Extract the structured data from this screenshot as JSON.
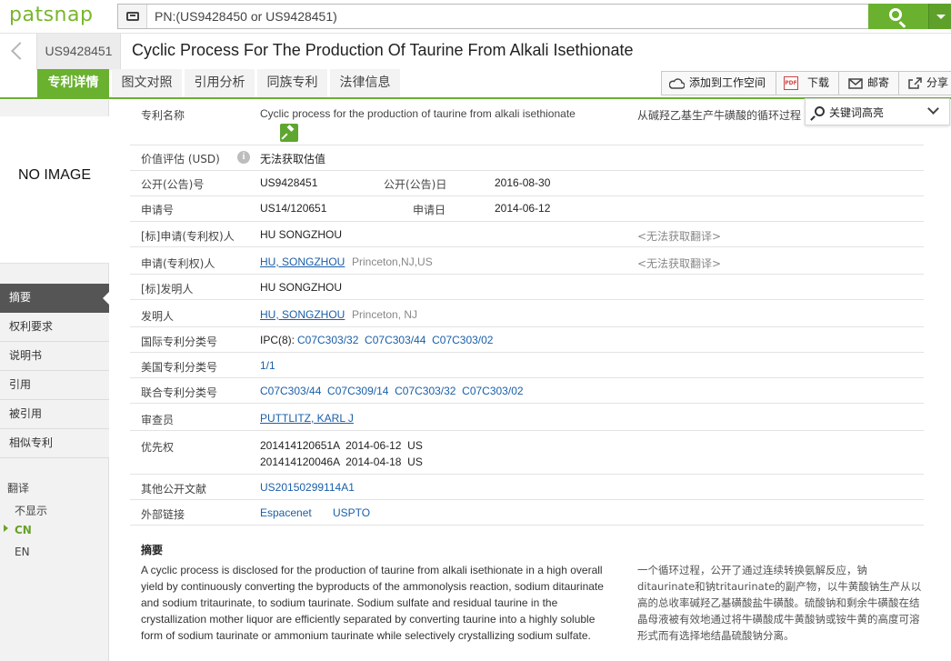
{
  "app": {
    "logo": "patsnap"
  },
  "search": {
    "query": "PN:(US9428450 or US9428451)"
  },
  "header": {
    "pn": "US9428451",
    "title": "Cyclic Process For The Production Of Taurine From Alkali Isethionate"
  },
  "tabs": [
    {
      "label": "专利详情",
      "active": true
    },
    {
      "label": "图文对照",
      "active": false
    },
    {
      "label": "引用分析",
      "active": false
    },
    {
      "label": "同族专利",
      "active": false
    },
    {
      "label": "法律信息",
      "active": false
    }
  ],
  "actions": {
    "add_workspace": "添加到工作空间",
    "pdf_badge": "PDF",
    "download": "下载",
    "email": "邮寄",
    "share": "分享"
  },
  "keyword_highlight": {
    "label": "关键词高亮"
  },
  "image": {
    "placeholder": "NO IMAGE"
  },
  "sidebar": {
    "items": [
      {
        "label": "摘要",
        "active": true
      },
      {
        "label": "权利要求",
        "active": false
      },
      {
        "label": "说明书",
        "active": false
      },
      {
        "label": "引用",
        "active": false
      },
      {
        "label": "被引用",
        "active": false
      },
      {
        "label": "相似专利",
        "active": false
      }
    ],
    "translate": {
      "title": "翻译",
      "options": [
        {
          "label": "不显示"
        },
        {
          "label": "CN",
          "selected": true
        },
        {
          "label": "EN"
        }
      ]
    }
  },
  "fields": {
    "title": {
      "label": "专利名称",
      "value": "Cyclic process for the production of taurine from alkali isethionate",
      "translation": "从碱羟乙基生产牛磺酸的循环过程"
    },
    "valuation": {
      "label": "价值评估 (USD)",
      "value": "无法获取估值"
    },
    "pub_no": {
      "label": "公开(公告)号",
      "value": "US9428451"
    },
    "pub_date": {
      "label": "公开(公告)日",
      "value": "2016-08-30"
    },
    "app_no": {
      "label": "申请号",
      "value": "US14/120651"
    },
    "app_date": {
      "label": "申请日",
      "value": "2014-06-12"
    },
    "std_applicant": {
      "label": "[标]申请(专利权)人",
      "value": "HU SONGZHOU",
      "translation": "<无法获取翻译>"
    },
    "applicant": {
      "label": "申请(专利权)人",
      "value": "HU, SONGZHOU",
      "location": "Princeton,NJ,US",
      "translation": "<无法获取翻译>"
    },
    "std_inventor": {
      "label": "[标]发明人",
      "value": "HU SONGZHOU"
    },
    "inventor": {
      "label": "发明人",
      "value": "HU, SONGZHOU",
      "location": "Princeton, NJ"
    },
    "ipc": {
      "label": "国际专利分类号",
      "prefix": "IPC(8):",
      "codes": "C07C303/32  C07C303/44  C07C303/02"
    },
    "uspc": {
      "label": "美国专利分类号",
      "value": "1/1"
    },
    "cpc": {
      "label": "联合专利分类号",
      "value": "C07C303/44  C07C309/14  C07C303/32  C07C303/02"
    },
    "examiner": {
      "label": "审查员",
      "value": "PUTTLITZ, KARL J"
    },
    "priority": {
      "label": "优先权",
      "line1": "201414120651A  2014-06-12  US",
      "line2": "201414120046A  2014-04-18  US"
    },
    "other_pubs": {
      "label": "其他公开文献",
      "value": "US20150299114A1"
    },
    "external": {
      "label": "外部链接",
      "link1": "Espacenet",
      "link2": "USPTO"
    }
  },
  "abstract": {
    "heading": "摘要",
    "en": "A cyclic process is disclosed for the production of taurine from alkali isethionate in a high overall yield by continuously converting the byproducts of the ammonolysis reaction, sodium ditaurinate and sodium tritaurinate, to sodium taurinate. Sodium sulfate and residual taurine in the crystallization mother liquor are efficiently separated by converting taurine into a highly soluble form of sodium taurinate or ammonium taurinate while selectively crystallizing sodium sulfate.",
    "zh": "一个循环过程，公开了通过连续转换氨解反应，钠ditaurinate和钠tritaurinate的副产物，以牛黄酸钠生产从以高的总收率碱羟乙基磺酸盐牛磺酸。硫酸钠和剩余牛磺酸在结晶母液被有效地通过将牛磺酸成牛黄酸钠或铵牛黄的高度可溶形式而有选择地结晶硫酸钠分离。"
  },
  "colors": {
    "brand": "#69b12f",
    "link": "#1a5fa8",
    "active_nav": "#555555"
  }
}
